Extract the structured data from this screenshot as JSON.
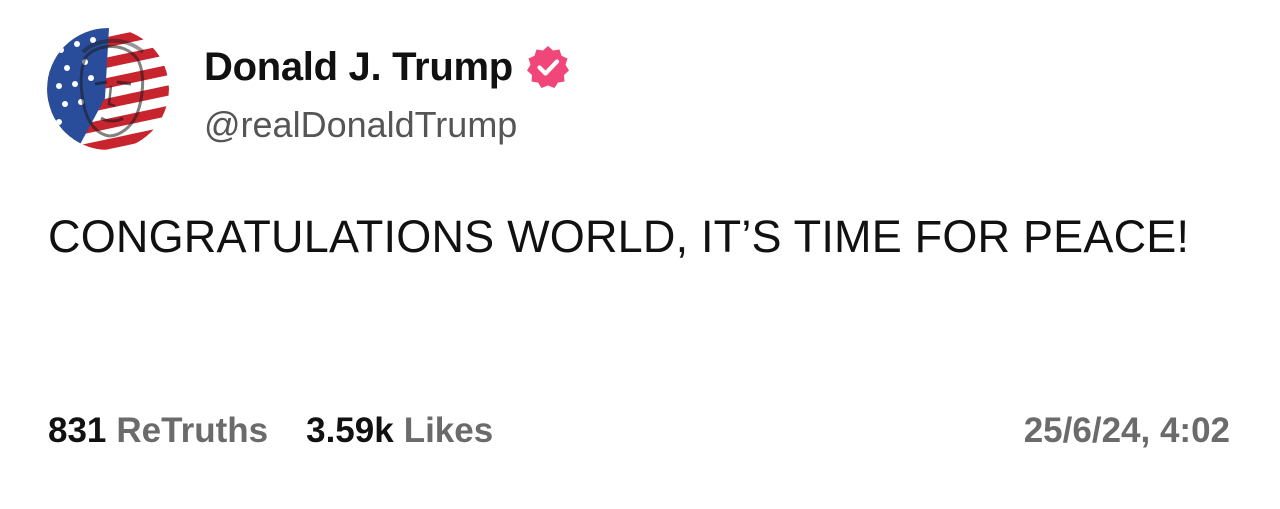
{
  "post": {
    "author": {
      "display_name": "Donald J. Trump",
      "handle": "@realDonaldTrump",
      "verified": true,
      "verified_badge_color": "#f0467a",
      "avatar_icon": "flag-portrait-avatar"
    },
    "text": "CONGRATULATIONS WORLD, IT’S TIME FOR PEACE!",
    "stats": {
      "retruths_count": "831",
      "retruths_label": "ReTruths",
      "likes_count": "3.59k",
      "likes_label": "Likes"
    },
    "timestamp": "25/6/24, 4:02"
  }
}
